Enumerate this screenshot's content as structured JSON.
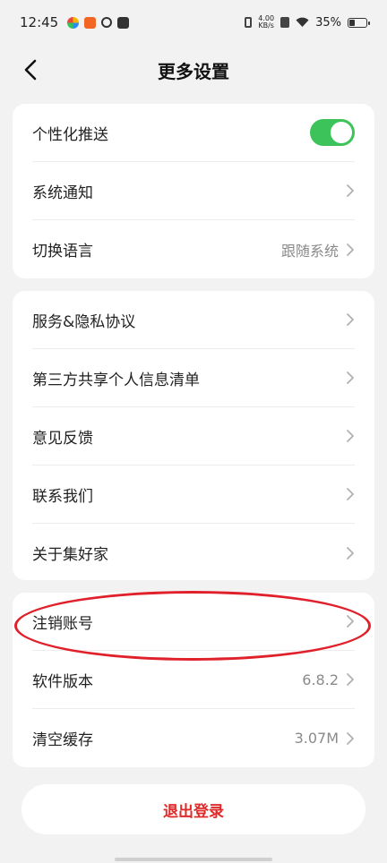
{
  "status_bar": {
    "time": "12:45",
    "net_speed_value": "4.00",
    "net_speed_unit": "KB/s",
    "battery_percent": "35%",
    "battery_level": 0.35
  },
  "header": {
    "title": "更多设置"
  },
  "card1": {
    "items": [
      {
        "label": "个性化推送",
        "toggle_on": true
      },
      {
        "label": "系统通知",
        "value": ""
      },
      {
        "label": "切换语言",
        "value": "跟随系统"
      }
    ]
  },
  "card2": {
    "items": [
      {
        "label": "服务&隐私协议"
      },
      {
        "label": "第三方共享个人信息清单"
      },
      {
        "label": "意见反馈"
      },
      {
        "label": "联系我们"
      },
      {
        "label": "关于集好家"
      }
    ]
  },
  "card3": {
    "items": [
      {
        "label": "注销账号",
        "value": ""
      },
      {
        "label": "软件版本",
        "value": "6.8.2"
      },
      {
        "label": "清空缓存",
        "value": "3.07M"
      }
    ]
  },
  "logout": {
    "label": "退出登录"
  },
  "colors": {
    "accent_green": "#3cc35a",
    "logout_red": "#e02a2a",
    "annotation_red": "#e0202a",
    "background": "#f2f2f2"
  }
}
